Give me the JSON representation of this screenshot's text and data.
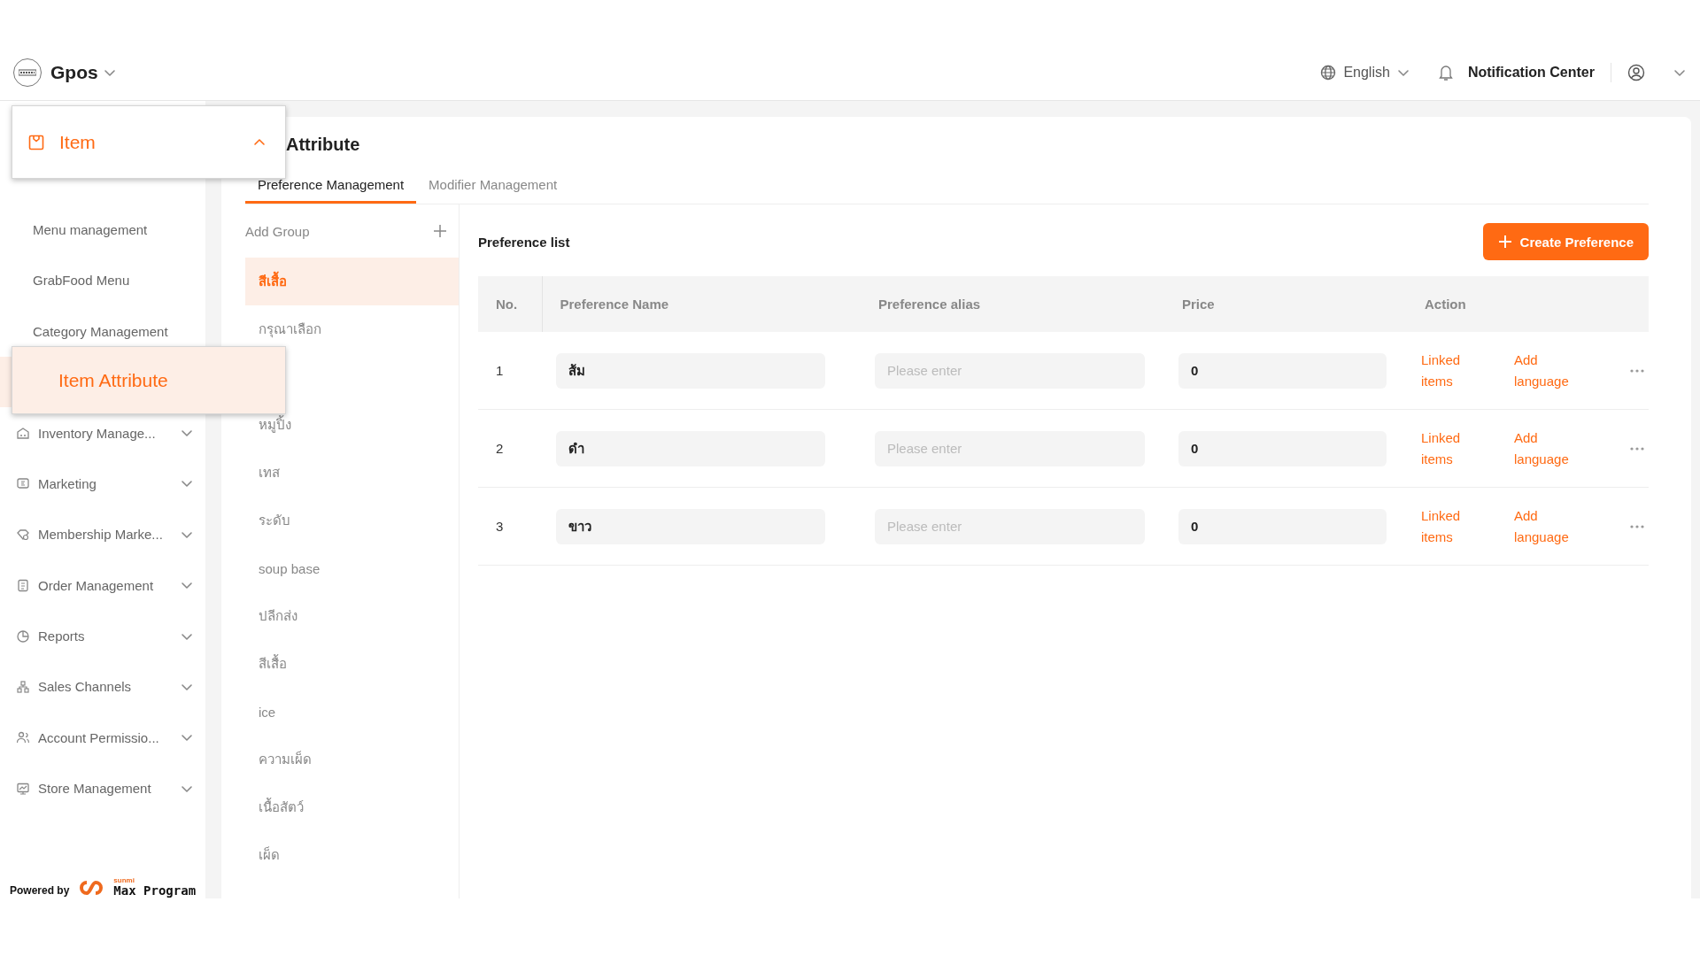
{
  "header": {
    "brand": "Gpos",
    "language": "English",
    "notifications": "Notification Center"
  },
  "callouts": [
    {
      "label": "Item",
      "expanded": true
    },
    {
      "label": "Item Attribute"
    }
  ],
  "sidebar": {
    "subitems": [
      "Menu management",
      "GrabFood Menu",
      "Category Management"
    ],
    "menus": [
      {
        "label": "Inventory Manage..."
      },
      {
        "label": "Marketing"
      },
      {
        "label": "Membership Marke..."
      },
      {
        "label": "Order Management"
      },
      {
        "label": "Reports"
      },
      {
        "label": "Sales Channels"
      },
      {
        "label": "Account Permissio..."
      },
      {
        "label": "Store Management"
      }
    ]
  },
  "powered": {
    "label": "Powered by",
    "small": "sunmi",
    "brand": "Max Program"
  },
  "page": {
    "title": "Attribute",
    "tabs": [
      {
        "label": "Preference Management",
        "selected": true
      },
      {
        "label": "Modifier Management",
        "selected": false
      }
    ]
  },
  "groups": {
    "add_label": "Add Group",
    "items": [
      {
        "label": "สีเสื้อ",
        "selected": true
      },
      {
        "label": "กรุณาเลือก",
        "selected": false
      },
      {
        "label": "หมูปิ้ง",
        "selected": false
      },
      {
        "label": "เทส",
        "selected": false
      },
      {
        "label": "ระดับ",
        "selected": false
      },
      {
        "label": "soup base",
        "selected": false
      },
      {
        "label": "ปลีกส่ง",
        "selected": false
      },
      {
        "label": "สีเสื้อ",
        "selected": false
      },
      {
        "label": "ice",
        "selected": false
      },
      {
        "label": "ความเผ็ด",
        "selected": false
      },
      {
        "label": "เนื้อสัตว์",
        "selected": false
      },
      {
        "label": "เผ็ด",
        "selected": false
      }
    ]
  },
  "preferences": {
    "title": "Preference list",
    "create_button": "Create Preference",
    "columns": [
      "No.",
      "Preference Name",
      "Preference alias",
      "Price",
      "Action"
    ],
    "rows": [
      {
        "no": "1",
        "name": "ส้ม",
        "alias": {
          "placeholder": "Please enter"
        },
        "price": "0",
        "actions": [
          "Linked items",
          "Add language"
        ]
      },
      {
        "no": "2",
        "name": "ดำ",
        "alias": {
          "placeholder": "Please enter"
        },
        "price": "0",
        "actions": [
          "Linked items",
          "Add language"
        ]
      },
      {
        "no": "3",
        "name": "ขาว",
        "alias": {
          "placeholder": "Please enter"
        },
        "price": "0",
        "actions": [
          "Linked items",
          "Add language"
        ]
      }
    ]
  }
}
